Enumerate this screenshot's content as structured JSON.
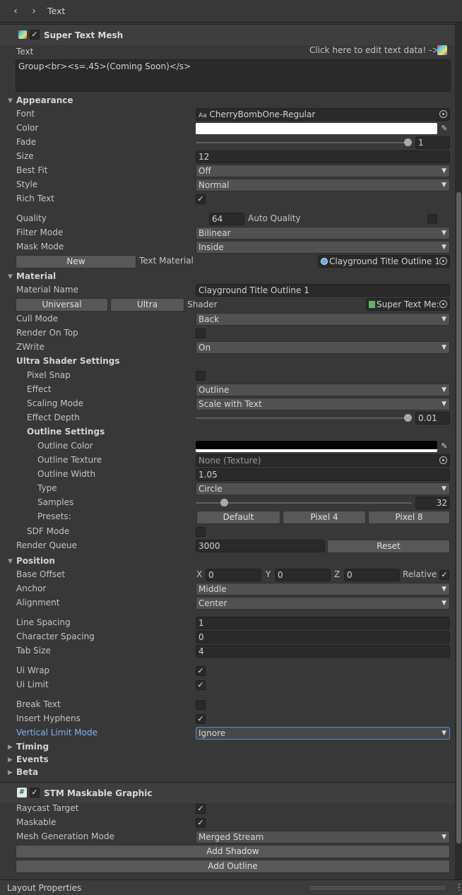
{
  "window": {
    "title": "Text",
    "back_glyph": "‹",
    "forward_glyph": "›"
  },
  "super_text_mesh": {
    "header": "Super Text Mesh",
    "text_label": "Text",
    "edit_hint": "Click here to edit text data! ->",
    "text_value": "Group<br><s=.45>(Coming Soon)</s>"
  },
  "appearance": {
    "section": "Appearance",
    "font_label": "Font",
    "font_prefix": "Aa",
    "font_value": "CherryBombOne-Regular",
    "color_label": "Color",
    "color_value": "#ffffff",
    "fade_label": "Fade",
    "fade_value": "1",
    "fade_fraction": 1.0,
    "size_label": "Size",
    "size_value": "12",
    "best_fit_label": "Best Fit",
    "best_fit_value": "Off",
    "style_label": "Style",
    "style_value": "Normal",
    "rich_text_label": "Rich Text",
    "quality_label": "Quality",
    "quality_value": "64",
    "auto_quality_label": "Auto Quality",
    "filter_mode_label": "Filter Mode",
    "filter_mode_value": "Bilinear",
    "mask_mode_label": "Mask Mode",
    "mask_mode_value": "Inside",
    "new_button": "New",
    "text_material_label": "Text Material",
    "text_material_value": "Clayground Title Outline 1"
  },
  "material": {
    "section": "Material",
    "name_label": "Material Name",
    "name_value": "Clayground Title Outline 1",
    "universal_button": "Universal",
    "ultra_button": "Ultra",
    "shader_label": "Shader",
    "shader_value": "Super Text Me:",
    "cull_mode_label": "Cull Mode",
    "cull_mode_value": "Back",
    "render_on_top_label": "Render On Top",
    "zwrite_label": "ZWrite",
    "zwrite_value": "On",
    "ultra_settings_label": "Ultra Shader Settings",
    "pixel_snap_label": "Pixel Snap",
    "effect_label": "Effect",
    "effect_value": "Outline",
    "scaling_mode_label": "Scaling Mode",
    "scaling_mode_value": "Scale with Text",
    "effect_depth_label": "Effect Depth",
    "effect_depth_value": "0.01",
    "effect_depth_fraction": 1.0,
    "outline_settings_label": "Outline Settings",
    "outline_color_label": "Outline Color",
    "outline_color_value": "#000000",
    "outline_texture_label": "Outline Texture",
    "outline_texture_value": "None (Texture)",
    "outline_width_label": "Outline Width",
    "outline_width_value": "1.05",
    "type_label": "Type",
    "type_value": "Circle",
    "samples_label": "Samples",
    "samples_value": "32",
    "samples_fraction": 0.13,
    "presets_label": "Presets:",
    "preset_default": "Default",
    "preset_pixel4": "Pixel 4",
    "preset_pixel8": "Pixel 8",
    "sdf_mode_label": "SDF Mode",
    "render_queue_label": "Render Queue",
    "render_queue_value": "3000",
    "reset_button": "Reset"
  },
  "position": {
    "section": "Position",
    "base_offset_label": "Base Offset",
    "x_label": "X",
    "x_value": "0",
    "y_label": "Y",
    "y_value": "0",
    "z_label": "Z",
    "z_value": "0",
    "relative_label": "Relative",
    "anchor_label": "Anchor",
    "anchor_value": "Middle",
    "alignment_label": "Alignment",
    "alignment_value": "Center",
    "line_spacing_label": "Line Spacing",
    "line_spacing_value": "1",
    "char_spacing_label": "Character Spacing",
    "char_spacing_value": "0",
    "tab_size_label": "Tab Size",
    "tab_size_value": "4",
    "ui_wrap_label": "Ui Wrap",
    "ui_limit_label": "Ui Limit",
    "break_text_label": "Break Text",
    "insert_hyphens_label": "Insert Hyphens",
    "vertical_limit_label": "Vertical Limit Mode",
    "vertical_limit_value": "Ignore"
  },
  "collapsed_sections": {
    "timing": "Timing",
    "events": "Events",
    "beta": "Beta"
  },
  "maskable": {
    "header": "STM Maskable Graphic",
    "raycast_label": "Raycast Target",
    "maskable_label": "Maskable",
    "mesh_gen_label": "Mesh Generation Mode",
    "mesh_gen_value": "Merged Stream",
    "add_shadow": "Add Shadow",
    "add_outline": "Add Outline"
  },
  "footer": {
    "label": "Layout Properties",
    "menu_glyph": "⋮"
  },
  "glyphs": {
    "check": "✓",
    "arrow_down": "▼",
    "fold_open": "▼",
    "fold_closed": "▶",
    "hash": "#",
    "eyedropper": "✎"
  },
  "colors": {
    "link_blue": "#7cb3f2",
    "focus_border": "#4a8fdf"
  }
}
